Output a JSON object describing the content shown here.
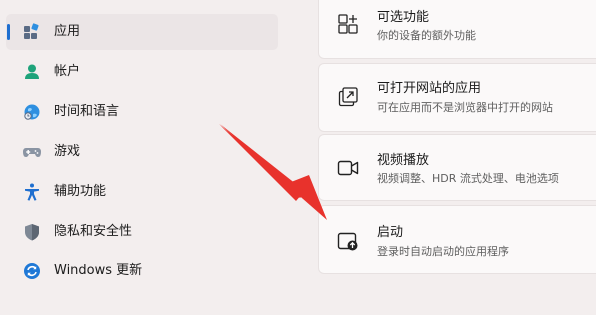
{
  "sidebar": {
    "items": [
      {
        "label": "应用",
        "icon": "apps-icon",
        "active": true
      },
      {
        "label": "帐户",
        "icon": "account-icon"
      },
      {
        "label": "时间和语言",
        "icon": "time-language-icon"
      },
      {
        "label": "游戏",
        "icon": "gamepad-icon"
      },
      {
        "label": "辅助功能",
        "icon": "accessibility-icon"
      },
      {
        "label": "隐私和安全性",
        "icon": "shield-icon"
      },
      {
        "label": "Windows 更新",
        "icon": "windows-update-icon"
      }
    ]
  },
  "main": {
    "cards": [
      {
        "title": "可选功能",
        "subtitle": "你的设备的额外功能",
        "icon": "optional-features-icon"
      },
      {
        "title": "可打开网站的应用",
        "subtitle": "可在应用而不是浏览器中打开的网站",
        "icon": "open-website-icon"
      },
      {
        "title": "视频播放",
        "subtitle": "视频调整、HDR 流式处理、电池选项",
        "icon": "video-icon"
      },
      {
        "title": "启动",
        "subtitle": "登录时自动启动的应用程序",
        "icon": "startup-icon"
      }
    ]
  },
  "colors": {
    "accent": "#1f6fd0",
    "arrow": "#e8322c"
  }
}
